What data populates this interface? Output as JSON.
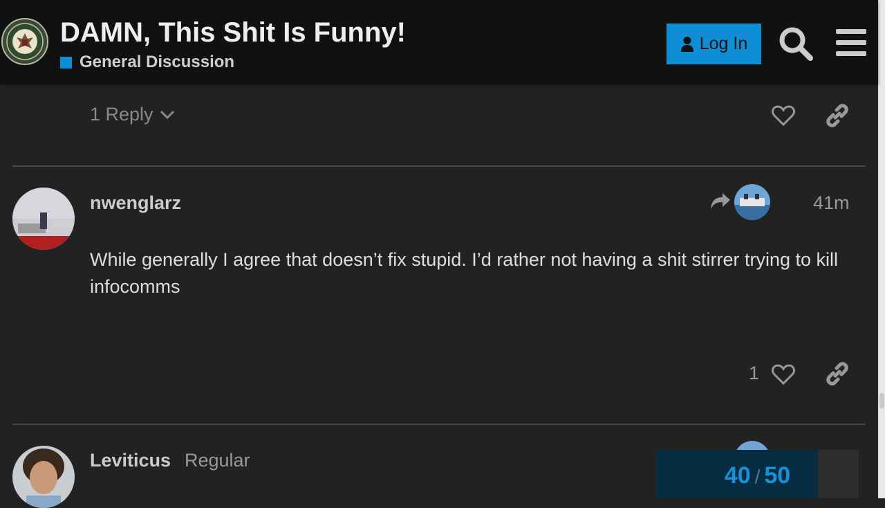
{
  "header": {
    "title": "DAMN, This Shit Is Funny!",
    "category": "General Discussion",
    "category_color": "#0e8fd5",
    "login_label": "Log In",
    "accent": "#0e8fd5",
    "logo_text_top": "INFOWARS",
    "logo_text_bottom": "ARMY"
  },
  "previous_post": {
    "replies_label": "1 Reply"
  },
  "posts": [
    {
      "username": "nwenglarz",
      "time": "41m",
      "body": "While generally I agree that doesn’t fix stupid. I’d rather not having a shit stirrer trying to kill infocomms",
      "likes": "1"
    },
    {
      "username": "Leviticus",
      "user_title": "Regular"
    }
  ],
  "progress": {
    "current": "40",
    "separator": "/",
    "total": "50",
    "fraction": 0.8
  }
}
